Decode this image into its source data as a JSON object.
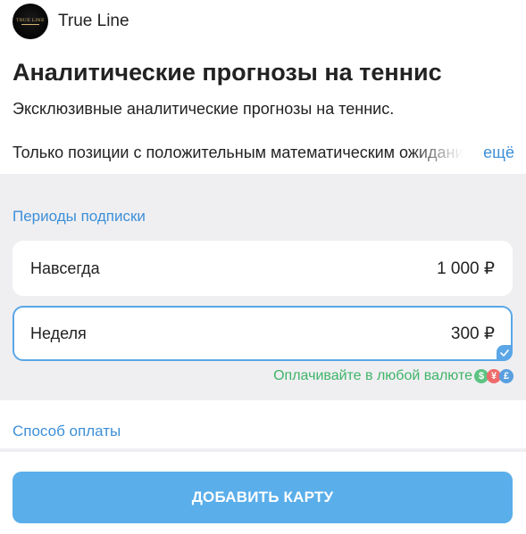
{
  "channel": {
    "logo_text": "TRUE LINE",
    "name": "True Line"
  },
  "main": {
    "title": "Аналитические прогнозы на теннис",
    "subtitle": "Эксклюзивные аналитические прогнозы на теннис.",
    "description": "Только позиции с положительным математическим ожиданием",
    "more_label": "ещё"
  },
  "periods": {
    "label": "Периоды подписки",
    "plans": [
      {
        "name": "Навсегда",
        "price": "1 000 ₽",
        "selected": false
      },
      {
        "name": "Неделя",
        "price": "300 ₽",
        "selected": true
      }
    ],
    "currency_note": "Оплачивайте в любой валюте",
    "currency_icons": [
      {
        "icon": "dollar-coin-icon",
        "glyph": "$",
        "color": "#5cc483"
      },
      {
        "icon": "yuan-coin-icon",
        "glyph": "¥",
        "color": "#ef6a6a"
      },
      {
        "icon": "pound-coin-icon",
        "glyph": "£",
        "color": "#5a9fe0"
      }
    ]
  },
  "payment": {
    "label": "Способ оплаты"
  },
  "actions": {
    "add_card_label": "ДОБАВИТЬ КАРТУ"
  },
  "colors": {
    "accent": "#3d8fd8",
    "button": "#5aaeea",
    "selected_border": "#5aa6e6",
    "section_bg": "#efeff2",
    "currency_note": "#3fb468"
  }
}
